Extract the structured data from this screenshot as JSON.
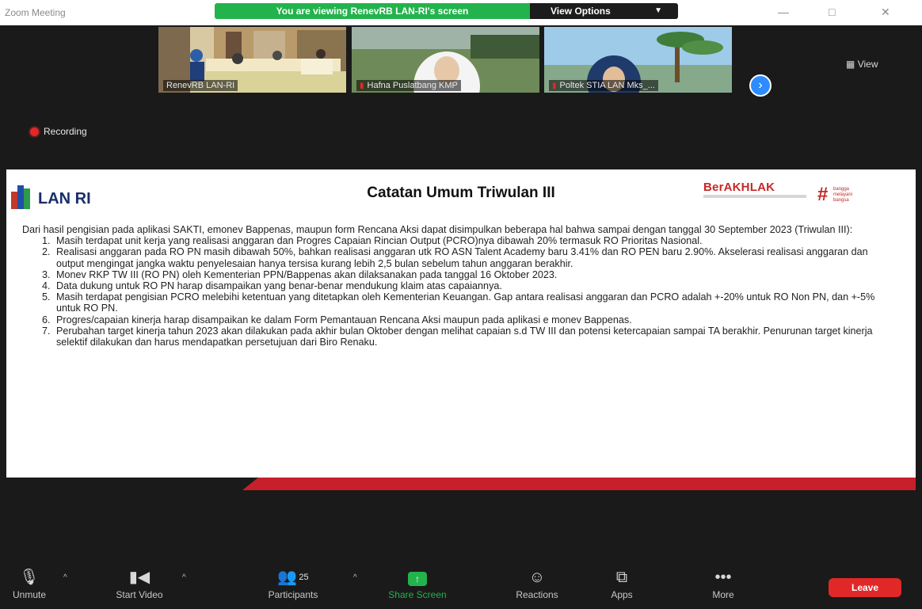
{
  "window": {
    "title": "Zoom Meeting",
    "share_banner": "You are viewing RenevRB LAN-RI's screen",
    "view_options": "View Options",
    "controls": {
      "minimize": "—",
      "maximize": "□",
      "close": "✕"
    }
  },
  "video": {
    "tiles": [
      {
        "name": "RenevRB LAN-RI",
        "muted": false
      },
      {
        "name": "Hafna Puslatbang KMP",
        "muted": true
      },
      {
        "name": "Poltek STIA LAN Mks_...",
        "muted": true
      }
    ],
    "next_icon": "›",
    "view_label": "View",
    "recording_label": "Recording"
  },
  "slide": {
    "logo_text": "LAN RI",
    "title": "Catatan Umum Triwulan III",
    "berakhlak_text": "BerAKHLAK",
    "bangga_mark": "#",
    "bangga_lines": [
      "bangga",
      "melayani",
      "bangsa"
    ],
    "intro": "Dari hasil pengisian pada aplikasi SAKTI, emonev Bappenas, maupun form Rencana Aksi dapat disimpulkan beberapa hal bahwa sampai dengan tanggal 30 September 2023 (Triwulan III):",
    "items": [
      "Masih terdapat unit kerja yang realisasi anggaran dan Progres Capaian Rincian Output (PCRO)nya dibawah 20% termasuk RO Prioritas Nasional.",
      "Realisasi anggaran pada RO PN masih dibawah 50%, bahkan realisasi anggaran utk RO ASN Talent Academy baru 3.41% dan RO PEN baru 2.90%. Akselerasi realisasi anggaran dan output mengingat jangka waktu penyelesaian hanya tersisa kurang lebih 2,5 bulan sebelum tahun anggaran berakhir.",
      "Monev RKP TW III (RO PN) oleh Kementerian PPN/Bappenas akan dilaksanakan pada tanggal 16 Oktober 2023.",
      "Data dukung untuk RO PN harap disampaikan yang benar-benar mendukung klaim atas capaiannya.",
      "Masih terdapat pengisian PCRO melebihi ketentuan yang ditetapkan oleh Kementerian Keuangan. Gap antara realisasi anggaran dan PCRO adalah +-20% untuk RO Non PN, dan +-5% untuk RO PN.",
      "Progres/capaian kinerja harap disampaikan ke dalam Form Pemantauan Rencana Aksi maupun pada aplikasi e monev Bappenas.",
      "Perubahan target kinerja tahun 2023 akan dilakukan pada akhir bulan Oktober dengan melihat capaian s.d TW III dan potensi ketercapaian sampai TA berakhir. Penurunan target kinerja selektif dilakukan dan harus mendapatkan persetujuan dari Biro Renaku."
    ]
  },
  "toolbar": {
    "unmute": "Unmute",
    "start_video": "Start Video",
    "participants": "Participants",
    "participants_count": "25",
    "share_screen": "Share Screen",
    "reactions": "Reactions",
    "apps": "Apps",
    "more": "More",
    "leave": "Leave"
  }
}
